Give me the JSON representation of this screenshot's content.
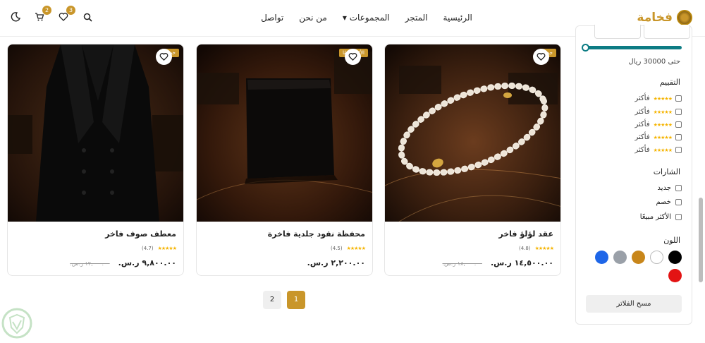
{
  "header": {
    "logo_text": "فخامة",
    "nav": {
      "home": "الرئيسية",
      "store": "المتجر",
      "collections": "المجموعات ▾",
      "about": "من نحن",
      "contact": "تواصل"
    },
    "wishlist_count": "3",
    "cart_count": "2"
  },
  "filters": {
    "price_label": "حتى 30000 ريال",
    "rating_title": "التقييم",
    "rating_option_label": "فأكثر",
    "rating_stars": "★★★★★",
    "badges_title": "الشارات",
    "badges": [
      "جديد",
      "خصم",
      "الأكثر مبيعًا"
    ],
    "color_title": "اللون",
    "colors": [
      "#000000",
      "#ffffff",
      "#c8861a",
      "#9aa0a8",
      "#1e66e8",
      "#e31313"
    ],
    "clear_button": "مسح الفلاتر"
  },
  "products": [
    {
      "name": "عقد لؤلؤ فاخر",
      "tag": "جديد",
      "stars": "★★★★★",
      "rating": "(4.8)",
      "price": "١٤,٥٠٠.٠٠ ر.س.",
      "old_price": "١٨,٠٠٠.٠٠ ر.س."
    },
    {
      "name": "محفظة نقود جلدية فاخرة",
      "tag": "الأكثر مبيعًا",
      "stars": "★★★★★",
      "rating": "(4.5)",
      "price": "٢,٢٠٠.٠٠ ر.س.",
      "old_price": ""
    },
    {
      "name": "معطف صوف فاخر",
      "tag": "خصم",
      "stars": "★★★★★",
      "rating": "(4.7)",
      "price": "٩,٨٠٠.٠٠ ر.س.",
      "old_price": "١٢,٠٠٠.٠٠ ر.س."
    }
  ],
  "pagination": {
    "page1": "1",
    "page2": "2"
  }
}
